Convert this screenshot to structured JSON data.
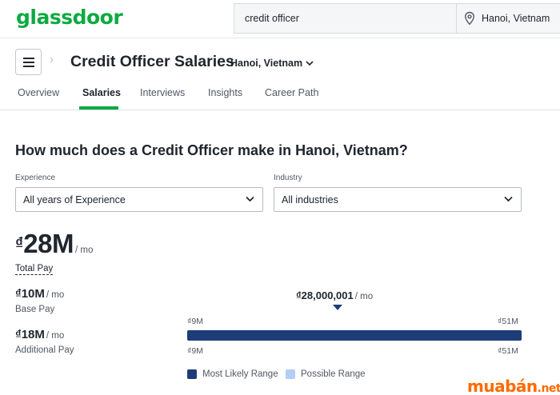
{
  "header": {
    "logo": "glassdoor",
    "search_value": "credit officer",
    "location_value": "Hanoi, Vietnam"
  },
  "title_row": {
    "title": "Credit Officer Salaries",
    "location": "Hanoi, Vietnam"
  },
  "tabs": [
    {
      "label": "Overview",
      "active": false
    },
    {
      "label": "Salaries",
      "active": true
    },
    {
      "label": "Interviews",
      "active": false
    },
    {
      "label": "Insights",
      "active": false
    },
    {
      "label": "Career Path",
      "active": false
    }
  ],
  "question": "How much does a Credit Officer make in Hanoi, Vietnam?",
  "filters": {
    "experience_label": "Experience",
    "experience_value": "All years of Experience",
    "industry_label": "Industry",
    "industry_value": "All industries"
  },
  "pay": {
    "currency": "₫",
    "total_amount": "28M",
    "per": "/ mo",
    "total_label": "Total Pay",
    "base_amount": "₫10M",
    "base_label": "Base Pay",
    "additional_amount": "₫18M",
    "additional_label": "Additional Pay",
    "median": "₫28,000,001"
  },
  "range": {
    "low_label": "₫9M",
    "high_label": "₫51M",
    "low": 9,
    "high": 51,
    "median": 28.000001,
    "most_likely_fraction": 1.0
  },
  "legend": {
    "most_likely": "Most Likely Range",
    "possible": "Possible Range"
  },
  "colors": {
    "brand": "#0caa41",
    "most_likely": "#1e3c78",
    "possible": "#b5ccf5",
    "watermark": "#ff6a00"
  },
  "watermark": {
    "text": "muabán",
    "tld": ".net"
  }
}
